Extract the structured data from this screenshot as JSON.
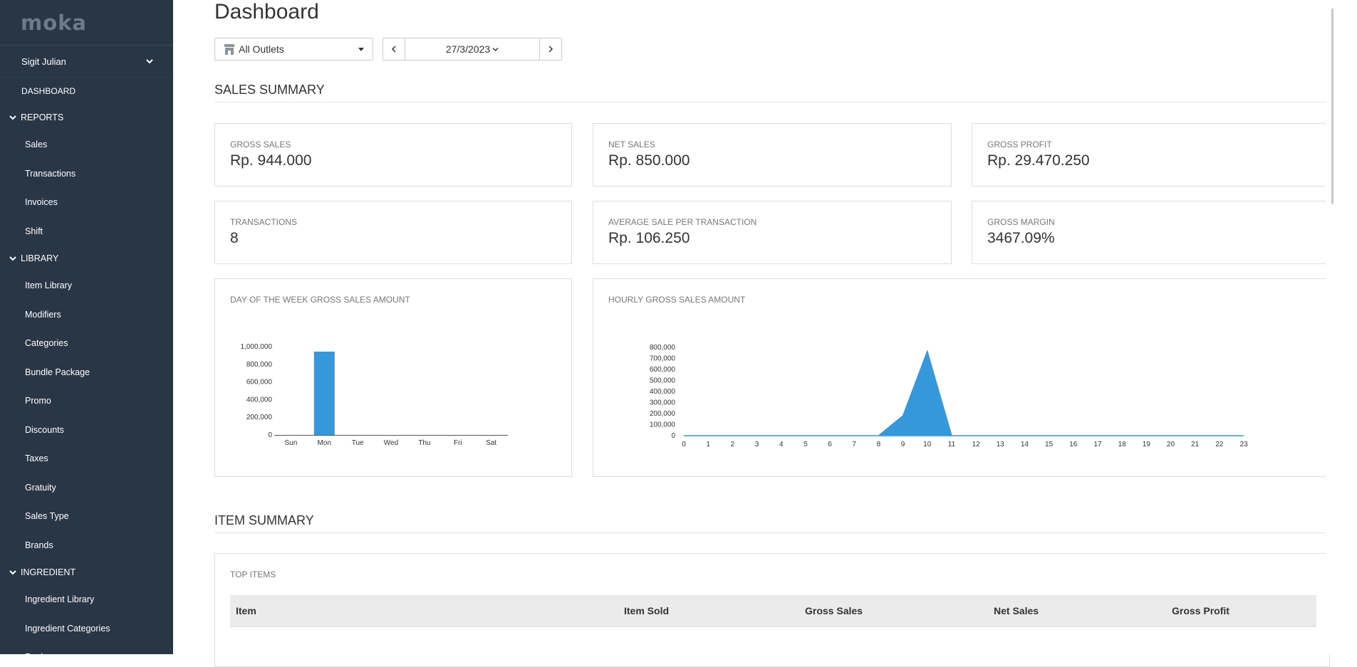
{
  "sidebar": {
    "logo": "moka",
    "user": "Sigit Julian",
    "dashboard": "DASHBOARD",
    "sections": [
      {
        "label": "REPORTS",
        "items": [
          "Sales",
          "Transactions",
          "Invoices",
          "Shift"
        ]
      },
      {
        "label": "LIBRARY",
        "items": [
          "Item Library",
          "Modifiers",
          "Categories",
          "Bundle Package",
          "Promo",
          "Discounts",
          "Taxes",
          "Gratuity",
          "Sales Type",
          "Brands"
        ]
      },
      {
        "label": "INGREDIENT",
        "items": [
          "Ingredient Library",
          "Ingredient Categories",
          "Recipes"
        ]
      }
    ]
  },
  "header": {
    "title": "Dashboard",
    "outlet": "All Outlets",
    "date": "27/3/2023"
  },
  "sales_summary": {
    "title": "SALES SUMMARY",
    "cards": [
      {
        "label": "GROSS SALES",
        "value": "Rp. 944.000"
      },
      {
        "label": "NET SALES",
        "value": "Rp. 850.000"
      },
      {
        "label": "GROSS PROFIT",
        "value": "Rp. 29.470.250"
      },
      {
        "label": "TRANSACTIONS",
        "value": "8"
      },
      {
        "label": "AVERAGE SALE PER TRANSACTION",
        "value": "Rp. 106.250"
      },
      {
        "label": "GROSS MARGIN",
        "value": "3467.09%"
      }
    ]
  },
  "chart_data": [
    {
      "type": "bar",
      "title": "DAY OF THE WEEK GROSS SALES AMOUNT",
      "categories": [
        "Sun",
        "Mon",
        "Tue",
        "Wed",
        "Thu",
        "Fri",
        "Sat"
      ],
      "values": [
        0,
        944000,
        0,
        0,
        0,
        0,
        0
      ],
      "yticks": [
        "0",
        "200,000",
        "400,000",
        "600,000",
        "800,000",
        "1,000,000"
      ],
      "ylim": [
        0,
        1000000
      ],
      "color": "#3498db"
    },
    {
      "type": "area",
      "title": "HOURLY GROSS SALES AMOUNT",
      "x": [
        0,
        1,
        2,
        3,
        4,
        5,
        6,
        7,
        8,
        9,
        10,
        11,
        12,
        13,
        14,
        15,
        16,
        17,
        18,
        19,
        20,
        21,
        22,
        23
      ],
      "values": [
        0,
        0,
        0,
        0,
        0,
        0,
        0,
        0,
        0,
        180000,
        764000,
        0,
        0,
        0,
        0,
        0,
        0,
        0,
        0,
        0,
        0,
        0,
        0,
        0
      ],
      "yticks": [
        "0",
        "100,000",
        "200,000",
        "300,000",
        "400,000",
        "500,000",
        "600,000",
        "700,000",
        "800,000"
      ],
      "ylim": [
        0,
        800000
      ],
      "color": "#3498db"
    }
  ],
  "item_summary": {
    "title": "ITEM SUMMARY",
    "card_label": "TOP ITEMS",
    "columns": [
      "Item",
      "Item Sold",
      "Gross Sales",
      "Net Sales",
      "Gross Profit"
    ]
  }
}
